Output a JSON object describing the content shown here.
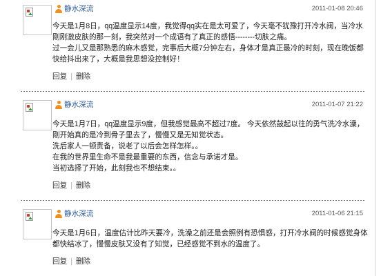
{
  "posts": [
    {
      "username": "静水深流",
      "time": "2011-01-08 20:46",
      "paragraphs": [
        "今天是1月8日，qq温度显示14度，我觉得qq实在是太可爱了，今天毫不犹豫打开冷水阀，当冷水刚刚激皮肤的那一刻，我突然对一个成语有了真正的感悟--------切肤之痛。",
        "过一会儿又是那熟悉的麻木感觉，完事后大概7分钟左右，身体才是真正最冷的时刻，现在晚饭都快给抖出来了，大概是我思想没控制好！"
      ],
      "actions": {
        "reply": "回复",
        "separator": "|",
        "delete": "删除"
      }
    },
    {
      "username": "静水深流",
      "time": "2011-01-07 21:22",
      "paragraphs": [
        "今天是1月7日，qq温度显示9度，但我感觉最高不超过7度。 今天依然鼓起以往的勇气洗冷水澡，刚开始真的是冷到骨子里去了，慢慢又是无知觉状态。",
        "洗后家人一顿责备，说老了以后会怎样怎样。。",
        "在我的世界里生命不是我最重要的东西，信念与承诺才是。",
        "当初选择了开始，此刻我也不想结束。。"
      ],
      "actions": {
        "reply": "回复",
        "separator": "|",
        "delete": "删除"
      }
    },
    {
      "username": "静水深流",
      "time": "2011-01-06 21:15",
      "paragraphs": [
        "今天是1月6日，温度估计比昨天要冷，洗澡之前还是会照例有恐惧感，打开冷水阀的时候感觉身体都快结冰了，慢慢皮肤又没有了知觉，已经感觉不到水的温度了。"
      ],
      "actions": {
        "reply": "回复",
        "separator": "|",
        "delete": "删除"
      }
    }
  ],
  "icons": {
    "avatar_placeholder": "broken-image-icon",
    "user_badge": "user-icon"
  },
  "colors": {
    "username": "#2c5b9b",
    "text": "#222222",
    "timestamp": "#555555",
    "action_link": "#333333",
    "action_separator": "#b5b5b5",
    "divider": "#6f6f6f",
    "user_icon": "#f0901e",
    "frame_border": "#cfcfcf",
    "avatar_border": "#c4c4c4"
  }
}
